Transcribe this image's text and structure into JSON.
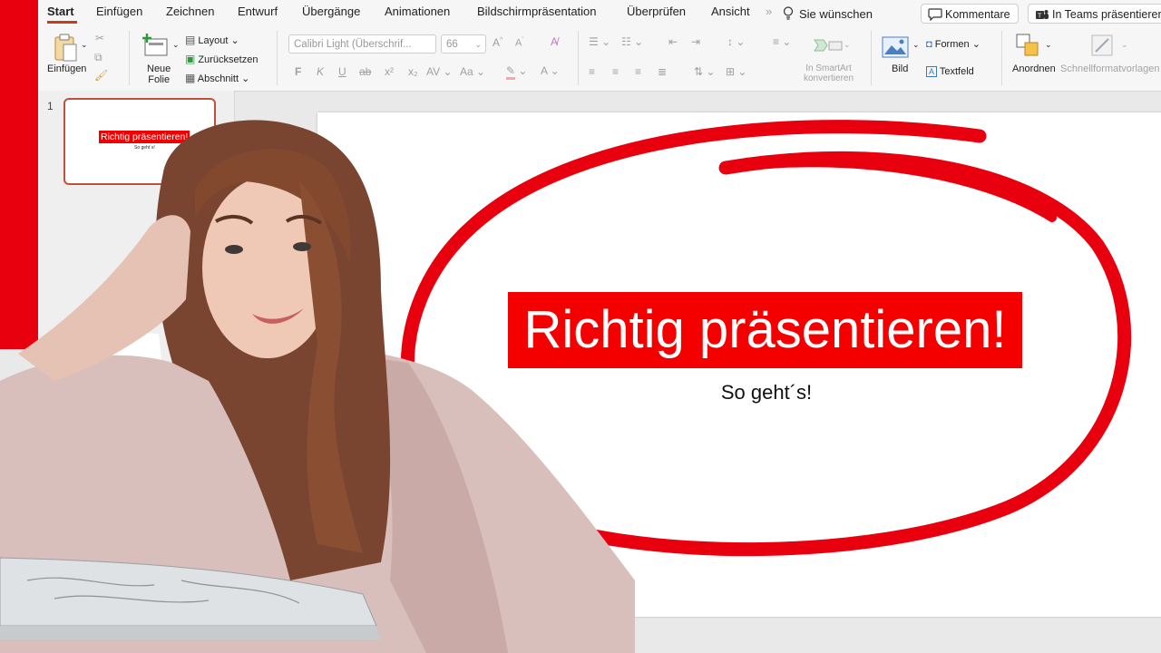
{
  "ribbon_tabs": [
    "Start",
    "Einfügen",
    "Zeichnen",
    "Entwurf",
    "Übergänge",
    "Animationen",
    "Bildschirmpräsentation",
    "Überprüfen",
    "Ansicht"
  ],
  "tell_me": "Sie wünschen",
  "top_buttons": {
    "comments": "Kommentare",
    "teams": "In Teams präsentieren"
  },
  "clipboard": {
    "paste": "Einfügen"
  },
  "slides_group": {
    "new_slide_line1": "Neue",
    "new_slide_line2": "Folie",
    "layout": "Layout",
    "reset": "Zurücksetzen",
    "section": "Abschnitt"
  },
  "font": {
    "family": "Calibri Light (Überschrif...",
    "size": "66",
    "bold": "F",
    "italic": "K",
    "underline": "U",
    "strike": "ab",
    "superscript": "x²",
    "subscript": "x₂",
    "spacing": "AV",
    "case": "Aa",
    "color_letter": "A"
  },
  "smartart": {
    "line1": "In SmartArt",
    "line2": "konvertieren"
  },
  "insert_group": {
    "picture": "Bild",
    "shapes": "Formen",
    "textbox": "Textfeld"
  },
  "arrange": {
    "arrange": "Anordnen",
    "quick_styles": "Schnellformatvorlagen"
  },
  "thumbnail": {
    "number": "1",
    "title": "Richtig präsentieren!",
    "subtitle": "So geht´s!"
  },
  "slide": {
    "title": "Richtig präsentieren!",
    "subtitle": "So geht´s!"
  },
  "colors": {
    "accent": "#c43e1c",
    "highlight_red": "#f40000",
    "circle_red": "#e8000e"
  }
}
